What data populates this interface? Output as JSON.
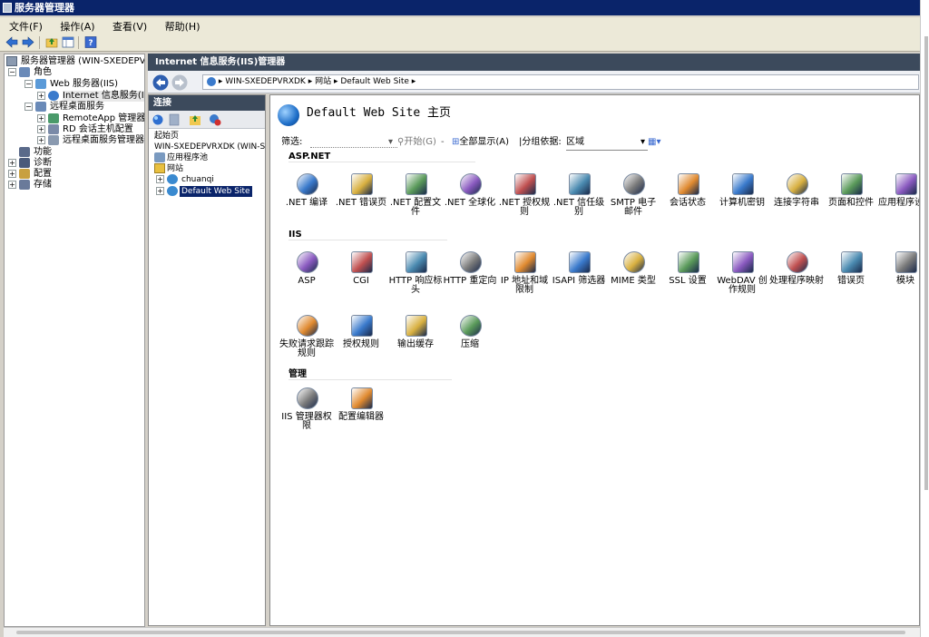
{
  "window": {
    "title": "服务器管理器"
  },
  "menu": [
    "文件(F)",
    "操作(A)",
    "查看(V)",
    "帮助(H)"
  ],
  "left_tree": [
    {
      "label": "服务器管理器 (WIN-SXEDEPVRXD",
      "icon": "server-manager-icon"
    },
    {
      "label": "角色",
      "icon": "roles-icon"
    },
    {
      "label": "Web 服务器(IIS)",
      "icon": "web-server-icon"
    },
    {
      "label": "Internet 信息服务(I",
      "icon": "iis-icon"
    },
    {
      "label": "远程桌面服务",
      "icon": "remote-desktop-icon"
    },
    {
      "label": "RemoteApp 管理器 (V",
      "icon": "remoteapp-icon"
    },
    {
      "label": "RD 会话主机配置",
      "icon": "rd-session-icon"
    },
    {
      "label": "远程桌面服务管理器",
      "icon": "rds-manager-icon"
    },
    {
      "label": "功能",
      "icon": "features-icon"
    },
    {
      "label": "诊断",
      "icon": "diagnostics-icon"
    },
    {
      "label": "配置",
      "icon": "configuration-icon"
    },
    {
      "label": "存储",
      "icon": "storage-icon"
    }
  ],
  "iis": {
    "header": "Internet 信息服务(IIS)管理器",
    "breadcrumb": [
      "WIN-SXEDEPVRXDK",
      "网站",
      "Default Web Site"
    ]
  },
  "connections": {
    "header": "连接",
    "items": [
      "起始页",
      "WIN-SXEDEPVRXDK (WIN-SXEDE",
      "应用程序池",
      "网站",
      "chuanqi",
      "Default Web Site"
    ]
  },
  "main": {
    "title": "Default Web Site 主页",
    "filter": {
      "label": "筛选:",
      "start": "开始(G)",
      "show_all": "全部显示(A)",
      "group_label": "分组依据:",
      "group_value": "区域"
    },
    "sections": [
      {
        "name": "ASP.NET",
        "items": [
          {
            "label": ".NET 编译",
            "icon": "dotnet-compile-icon"
          },
          {
            "label": ".NET 错误页",
            "icon": "dotnet-error-page-icon"
          },
          {
            "label": ".NET 配置文件",
            "icon": "dotnet-profile-icon"
          },
          {
            "label": ".NET 全球化",
            "icon": "dotnet-globalization-icon"
          },
          {
            "label": ".NET 授权规则",
            "icon": "dotnet-authorization-icon"
          },
          {
            "label": ".NET 信任级别",
            "icon": "dotnet-trust-icon"
          },
          {
            "label": "SMTP 电子邮件",
            "icon": "smtp-email-icon"
          },
          {
            "label": "会话状态",
            "icon": "session-state-icon"
          },
          {
            "label": "计算机密钥",
            "icon": "machine-key-icon"
          },
          {
            "label": "连接字符串",
            "icon": "connection-string-icon"
          },
          {
            "label": "页面和控件",
            "icon": "pages-controls-icon"
          },
          {
            "label": "应用程序设置",
            "icon": "app-settings-icon"
          }
        ]
      },
      {
        "name": "IIS",
        "items": [
          {
            "label": "ASP",
            "icon": "asp-icon"
          },
          {
            "label": "CGI",
            "icon": "cgi-icon"
          },
          {
            "label": "HTTP 响应标头",
            "icon": "http-headers-icon"
          },
          {
            "label": "HTTP 重定向",
            "icon": "http-redirect-icon"
          },
          {
            "label": "IP 地址和域限制",
            "icon": "ip-restrictions-icon"
          },
          {
            "label": "ISAPI 筛选器",
            "icon": "isapi-filters-icon"
          },
          {
            "label": "MIME 类型",
            "icon": "mime-types-icon"
          },
          {
            "label": "SSL 设置",
            "icon": "ssl-settings-icon"
          },
          {
            "label": "WebDAV 创作规则",
            "icon": "webdav-icon"
          },
          {
            "label": "处理程序映射",
            "icon": "handler-mappings-icon"
          },
          {
            "label": "错误页",
            "icon": "error-pages-icon"
          },
          {
            "label": "模块",
            "icon": "modules-icon"
          },
          {
            "label": "失败请求跟踪规则",
            "icon": "failed-request-icon"
          },
          {
            "label": "授权规则",
            "icon": "authorization-rules-icon"
          },
          {
            "label": "输出缓存",
            "icon": "output-cache-icon"
          },
          {
            "label": "压缩",
            "icon": "compression-icon"
          }
        ]
      },
      {
        "name": "管理",
        "items": [
          {
            "label": "IIS 管理器权限",
            "icon": "iis-manager-permissions-icon"
          },
          {
            "label": "配置编辑器",
            "icon": "config-editor-icon"
          }
        ]
      }
    ]
  },
  "colors": {
    "title_bar": "#0a246a",
    "panel_header": "#3c4a5c",
    "selection": "#0a246a"
  }
}
